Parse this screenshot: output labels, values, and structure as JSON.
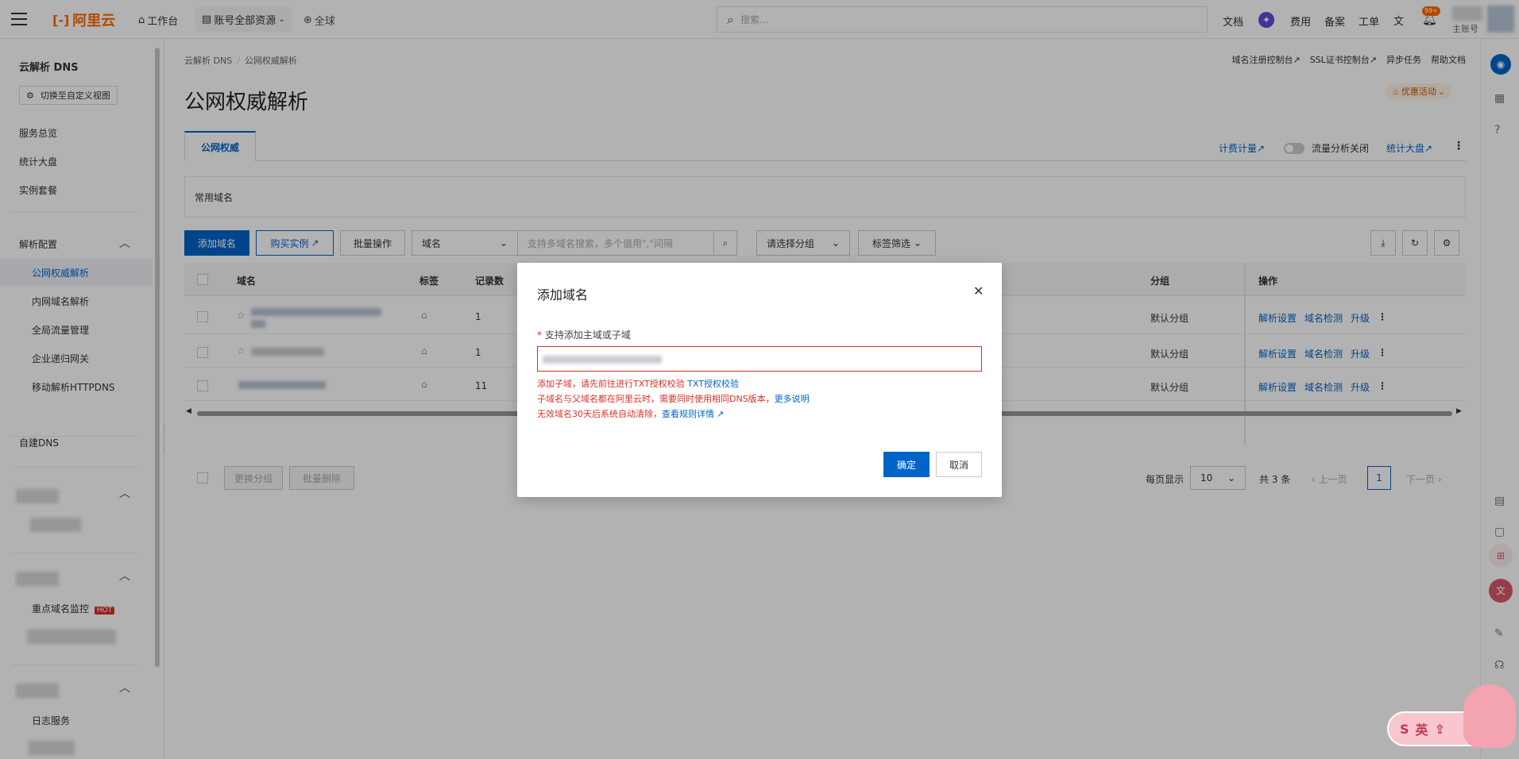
{
  "topbar": {
    "logo": "阿里云",
    "workbench": "工作台",
    "account_resources": "账号全部资源",
    "region": "全球",
    "search_placeholder": "搜索...",
    "docs": "文档",
    "fees": "费用",
    "filing": "备案",
    "ticket": "工单",
    "notif_badge": "99+",
    "account_label": "主账号"
  },
  "sidebar": {
    "product": "云解析 DNS",
    "switch_view": "切换至自定义视图",
    "items": [
      "服务总览",
      "统计大盘",
      "实例套餐"
    ],
    "group_parse": "解析配置",
    "parse_items": [
      "公网权威解析",
      "内网域名解析",
      "全局流量管理",
      "企业递归网关",
      "移动解析HTTPDNS"
    ],
    "self_dns": "自建DNS",
    "monitor": "重点域名监控",
    "hot": "HOT",
    "log_service": "日志服务"
  },
  "main": {
    "breadcrumb": [
      "云解析 DNS",
      "公网权威解析"
    ],
    "top_links": [
      "域名注册控制台",
      "SSL证书控制台",
      "异步任务",
      "帮助文档"
    ],
    "title": "公网权威解析",
    "promo": "优惠活动",
    "tab": "公网权威",
    "billing": "计费计量",
    "traffic_toggle": "流量分析关闭",
    "dashboard": "统计大盘",
    "common_domains": "常用域名",
    "toolbar": {
      "add_domain": "添加域名",
      "buy_instance": "购买实例",
      "batch": "批量操作",
      "field_select": "域名",
      "search_placeholder": "支持多域名搜索，多个值用\",\"间隔",
      "group_select": "请选择分组",
      "tag_filter": "标签筛选"
    },
    "table": {
      "headers": [
        "域名",
        "标签",
        "记录数",
        "分组",
        "操作"
      ],
      "rows": [
        {
          "records": "1",
          "group": "默认分组",
          "ops": [
            "解析设置",
            "域名检测",
            "升级"
          ]
        },
        {
          "records": "1",
          "group": "默认分组",
          "ops": [
            "解析设置",
            "域名检测",
            "升级"
          ]
        },
        {
          "records": "11",
          "group": "默认分组",
          "ops": [
            "解析设置",
            "域名检测",
            "升级"
          ]
        }
      ]
    },
    "footer": {
      "change_group": "更换分组",
      "batch_delete": "批量删除",
      "per_page_label": "每页显示",
      "per_page": "10",
      "total": "共 3 条",
      "prev": "上一页",
      "page": "1",
      "next": "下一页"
    }
  },
  "dialog": {
    "title": "添加域名",
    "field_label": "支持添加主域或子域",
    "error1": "添加子域，请先前往进行TXT授权校验",
    "error1_link": "TXT授权校验",
    "error2": "子域名与父域名都在阿里云时，需要同时使用相同DNS版本，",
    "error2_link": "更多说明",
    "error3": "无效域名30天后系统自动清除，",
    "error3_link": "查看规则详情",
    "confirm": "确定",
    "cancel": "取消"
  },
  "colors": {
    "brand": "#ff6a00",
    "primary": "#0064c8",
    "error": "#d93026",
    "hot": "#d93026"
  }
}
